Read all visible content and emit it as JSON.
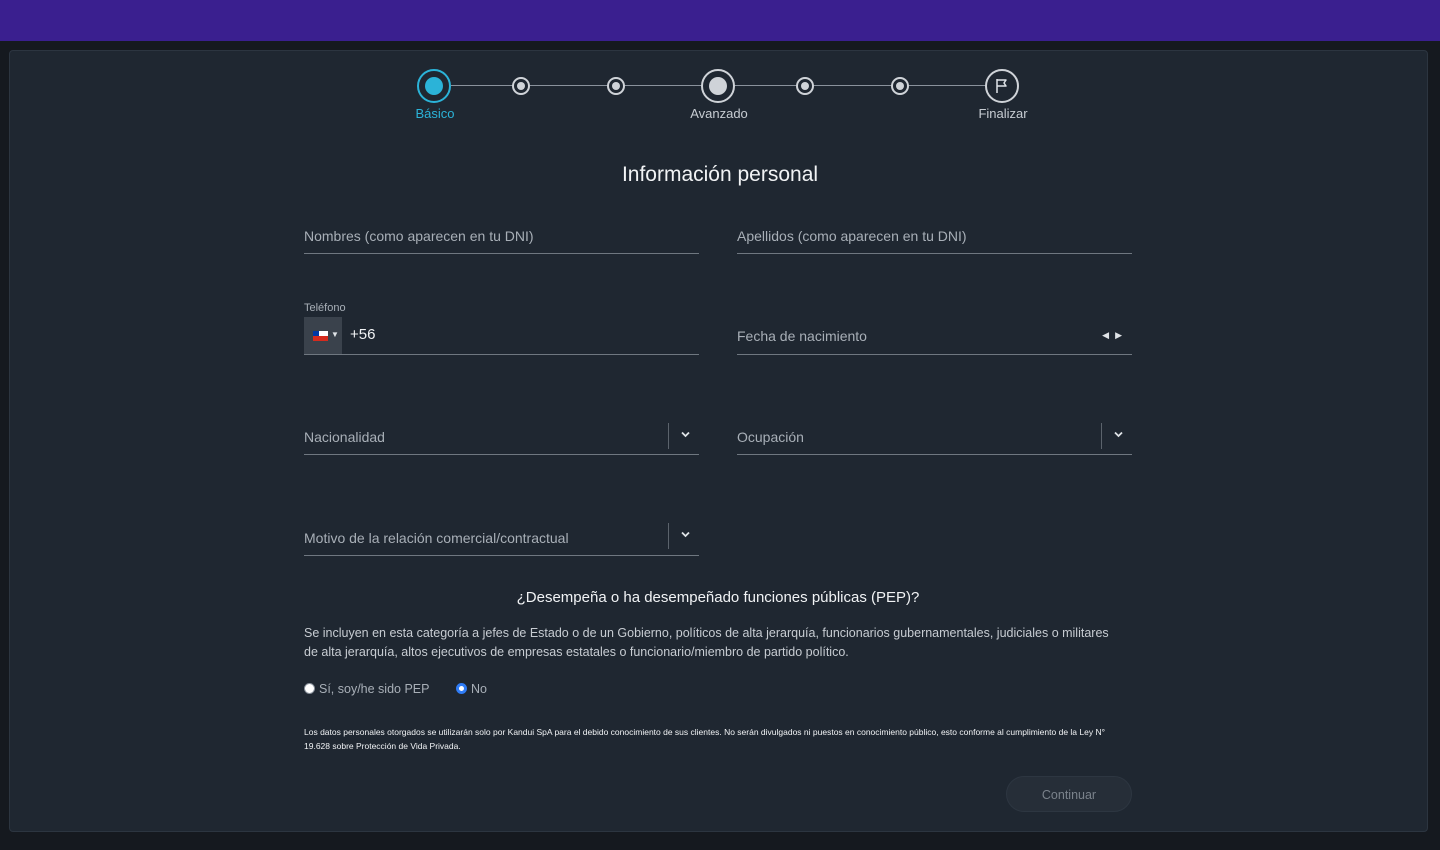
{
  "stepper": {
    "steps": [
      {
        "label": "Básico",
        "active": true
      },
      {
        "label": "Avanzado",
        "active": false
      },
      {
        "label": "Finalizar",
        "active": false
      }
    ],
    "finish_icon": "flag-icon"
  },
  "form": {
    "title": "Información personal",
    "first_name_placeholder": "Nombres (como aparecen en tu DNI)",
    "last_name_placeholder": "Apellidos (como aparecen en tu DNI)",
    "phone_label": "Teléfono",
    "phone_country_code": "+56",
    "phone_flag": "chile-flag-icon",
    "birthdate_placeholder": "Fecha de nacimiento",
    "nationality_placeholder": "Nacionalidad",
    "occupation_placeholder": "Ocupación",
    "relation_reason_placeholder": "Motivo de la relación comercial/contractual"
  },
  "pep": {
    "question": "¿Desempeña o ha desempeñado funciones públicas (PEP)?",
    "description": "Se incluyen en esta categoría a jefes de Estado o de un Gobierno, políticos de alta jerarquía, funcionarios gubernamentales, judiciales o militares de alta jerarquía, altos ejecutivos de empresas estatales o funcionario/miembro de partido político.",
    "option_yes": "Sí, soy/he sido PEP",
    "option_no": "No",
    "selected": "No"
  },
  "legal_notice": "Los datos personales otorgados se utilizarán solo por Kandui SpA para el debido conocimiento de sus clientes. No serán divulgados ni puestos en conocimiento público, esto conforme al cumplimiento de la Ley N° 19.628 sobre Protección de Vida Privada.",
  "actions": {
    "continue_label": "Continuar"
  },
  "colors": {
    "top_bar": "#3a1f8f",
    "accent": "#2bb3d8",
    "card_bg": "#1f2731"
  }
}
